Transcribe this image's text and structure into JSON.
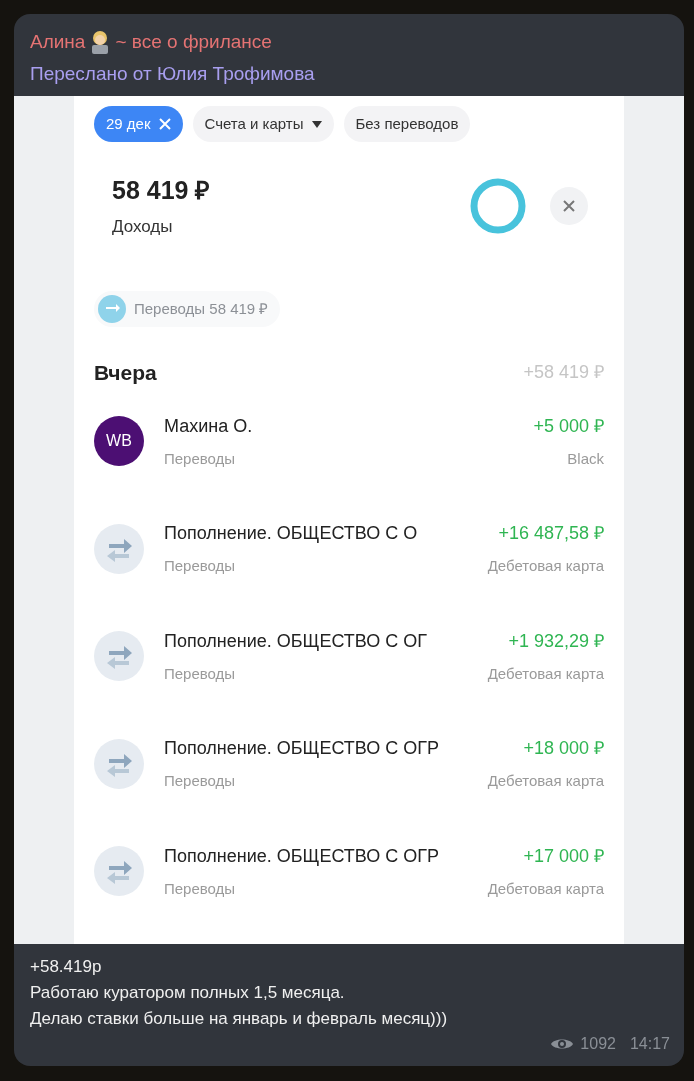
{
  "message": {
    "channel_name": "Алина",
    "channel_topic": "~ все о фрилансе",
    "forwarded_from": "Переслано от Юлия Трофимова"
  },
  "screenshot": {
    "chips": [
      {
        "label": "29 дек",
        "selected": true,
        "kind": "removable"
      },
      {
        "label": "Счета и карты",
        "selected": false,
        "kind": "dropdown"
      },
      {
        "label": "Без переводов",
        "selected": false,
        "kind": "plain"
      }
    ],
    "total": "58 419 ₽",
    "total_label": "Доходы",
    "category_chip": "Переводы 58 419 ₽",
    "day": "Вчера",
    "day_sum": "+58 419 ₽",
    "transactions": [
      {
        "kind": "logo",
        "logo_text": "WB",
        "title": "Махина О.",
        "category": "Переводы",
        "amount": "+5 000 ₽",
        "account": "Black"
      },
      {
        "kind": "transfer",
        "title": "Пополнение. ОБЩЕСТВО С О",
        "category": "Переводы",
        "amount": "+16 487,58 ₽",
        "account": "Дебетовая карта"
      },
      {
        "kind": "transfer",
        "title": "Пополнение. ОБЩЕСТВО С ОГ",
        "category": "Переводы",
        "amount": "+1 932,29 ₽",
        "account": "Дебетовая карта"
      },
      {
        "kind": "transfer",
        "title": "Пополнение. ОБЩЕСТВО С ОГР",
        "category": "Переводы",
        "amount": "+18 000 ₽",
        "account": "Дебетовая карта"
      },
      {
        "kind": "transfer",
        "title": "Пополнение. ОБЩЕСТВО С ОГР",
        "category": "Переводы",
        "amount": "+17 000 ₽",
        "account": "Дебетовая карта"
      }
    ]
  },
  "caption": [
    "+58.419р",
    "Работаю куратором полных 1,5 месяца.",
    "Делаю ставки больше на январь и февраль месяц)))"
  ],
  "views": "1092",
  "time": "14:17"
}
